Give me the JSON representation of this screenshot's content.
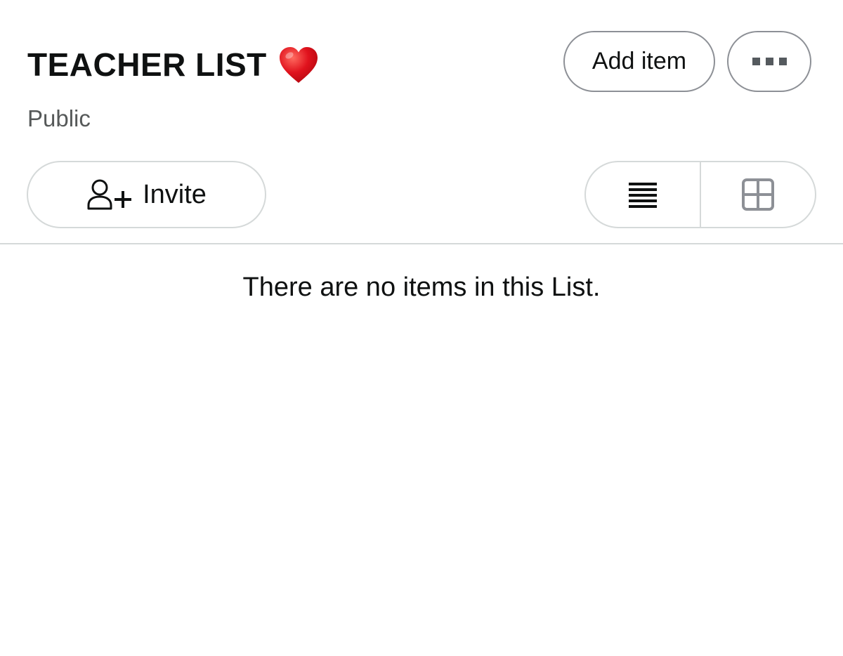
{
  "list": {
    "title": "TEACHER LIST",
    "title_emoji_icon": "red-heart-icon",
    "visibility": "Public"
  },
  "actions": {
    "add_item_label": "Add item",
    "more_icon": "ellipsis-icon",
    "invite_label": "Invite",
    "invite_icon": "add-person-icon"
  },
  "view_toggle": {
    "options": [
      {
        "icon": "list-view-icon",
        "selected": true
      },
      {
        "icon": "grid-view-icon",
        "selected": false
      }
    ]
  },
  "content": {
    "empty_message": "There are no items in this List."
  },
  "colors": {
    "heart": "#e0121d",
    "text_primary": "#0f1111",
    "text_secondary": "#565959",
    "border": "#d5d9d9"
  }
}
